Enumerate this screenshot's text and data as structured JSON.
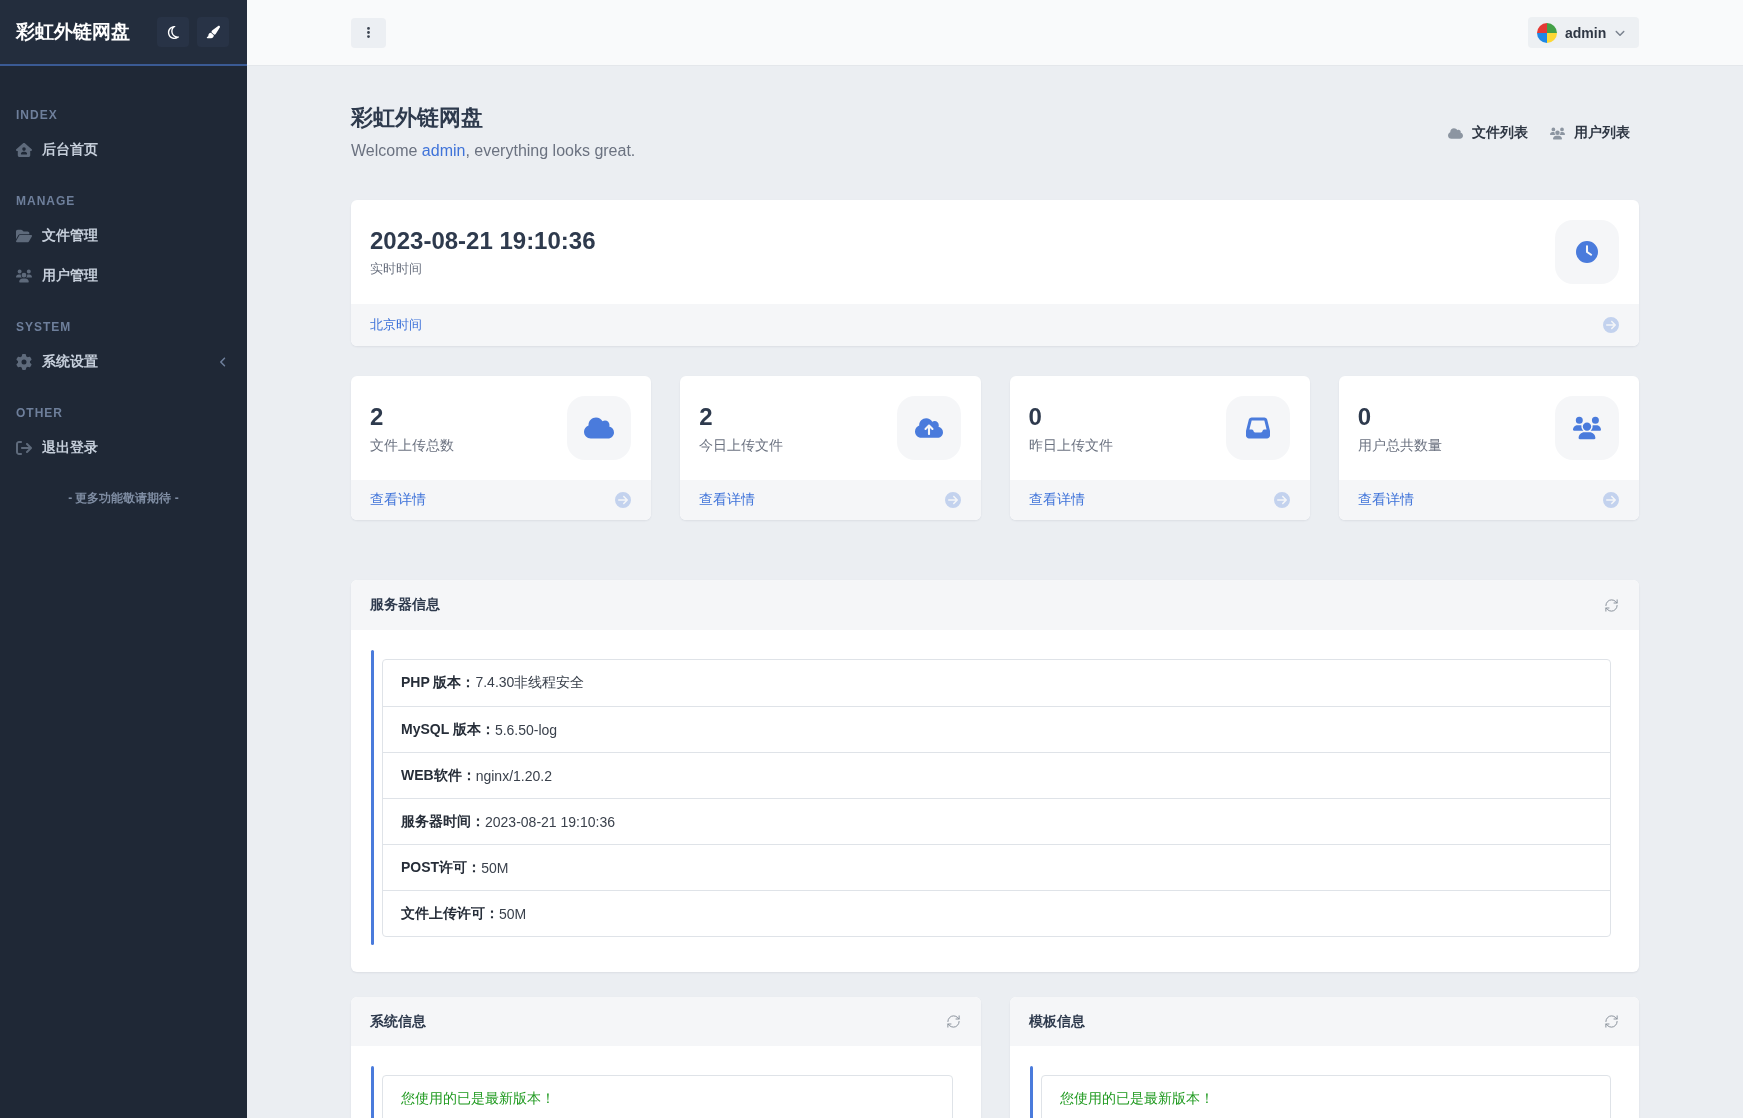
{
  "sidebar": {
    "brand": "彩虹外链网盘",
    "sections": [
      {
        "heading": "INDEX",
        "items": [
          {
            "label": "后台首页",
            "kind": "link"
          }
        ]
      },
      {
        "heading": "MANAGE",
        "items": [
          {
            "label": "文件管理",
            "kind": "link"
          },
          {
            "label": "用户管理",
            "kind": "link"
          }
        ]
      },
      {
        "heading": "SYSTEM",
        "items": [
          {
            "label": "系统设置",
            "kind": "submenu",
            "expanded": false
          }
        ]
      },
      {
        "heading": "OTHER",
        "items": [
          {
            "label": "退出登录",
            "kind": "link"
          }
        ]
      }
    ],
    "note": "- 更多功能敬请期待 -"
  },
  "top_bar": {
    "user": "admin"
  },
  "page_header": {
    "title": "彩虹外链网盘",
    "welcome": {
      "before": "Welcome ",
      "user": "admin",
      "after": ", everything looks great."
    },
    "links": [
      {
        "label": "文件列表"
      },
      {
        "label": "用户列表"
      }
    ]
  },
  "clock_card": {
    "time": "2023-08-21 19:10:36",
    "caption": "实时时间",
    "link": "北京时间"
  },
  "stats": [
    {
      "value": "2",
      "label": "文件上传总数",
      "link": "查看详情"
    },
    {
      "value": "2",
      "label": "今日上传文件",
      "link": "查看详情"
    },
    {
      "value": "0",
      "label": "昨日上传文件",
      "link": "查看详情"
    },
    {
      "value": "0",
      "label": "用户总共数量",
      "link": "查看详情"
    }
  ],
  "server_info": {
    "title": "服务器信息",
    "rows": [
      {
        "label": "PHP 版本：",
        "value": "7.4.30非线程安全"
      },
      {
        "label": "MySQL 版本：",
        "value": "5.6.50-log"
      },
      {
        "label": "WEB软件：",
        "value": "nginx/1.20.2"
      },
      {
        "label": "服务器时间：",
        "value": "2023-08-21 19:10:36"
      },
      {
        "label": "POST许可：",
        "value": "50M"
      },
      {
        "label": "文件上传许可：",
        "value": "50M"
      }
    ]
  },
  "panels": [
    {
      "title": "系统信息",
      "message": "您使用的已是最新版本！"
    },
    {
      "title": "模板信息",
      "message": "您使用的已是最新版本！"
    }
  ]
}
